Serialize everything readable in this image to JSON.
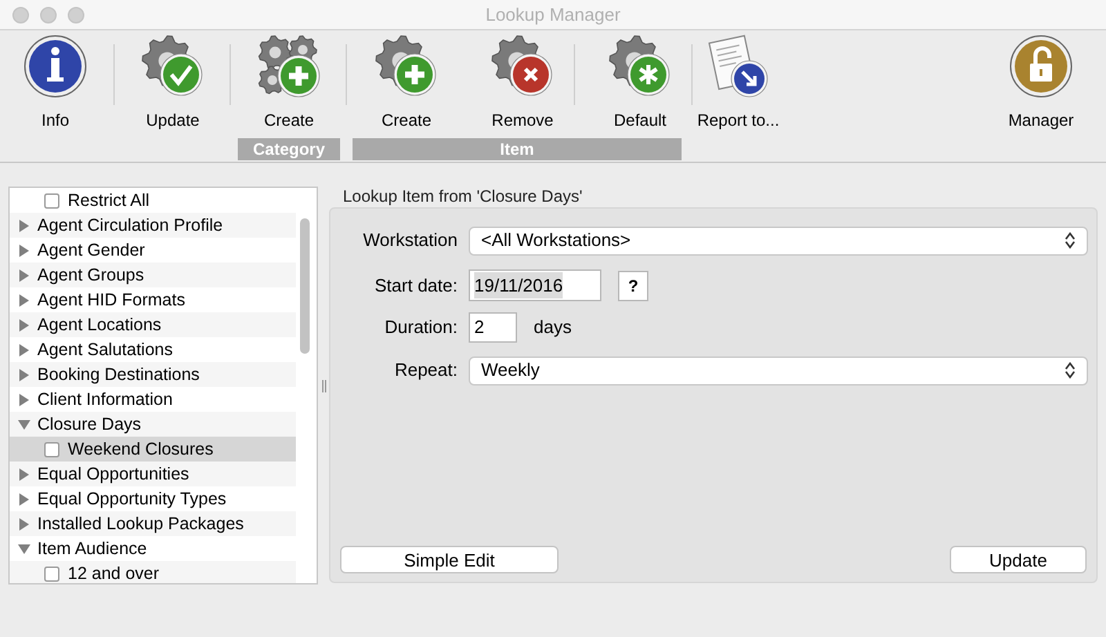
{
  "window": {
    "title": "Lookup Manager"
  },
  "toolbar": [
    {
      "label": "Info",
      "kind": "info"
    },
    {
      "label": "Update",
      "kind": "update"
    },
    {
      "label": "Create",
      "kind": "create_many"
    },
    {
      "label": "Create",
      "kind": "create"
    },
    {
      "label": "Remove",
      "kind": "remove"
    },
    {
      "label": "Default",
      "kind": "default"
    },
    {
      "label": "Report to...",
      "kind": "report"
    },
    {
      "label": "Manager",
      "kind": "lock"
    }
  ],
  "toolbar_groups": [
    {
      "label": "Category"
    },
    {
      "label": "Item"
    }
  ],
  "tree": [
    {
      "label": "Restrict All",
      "kind": "checkbox",
      "checked": false,
      "selected": false
    },
    {
      "label": "Agent Circulation Profile",
      "kind": "category",
      "expanded": false,
      "selected": false
    },
    {
      "label": "Agent Gender",
      "kind": "category",
      "expanded": false,
      "selected": false
    },
    {
      "label": "Agent Groups",
      "kind": "category",
      "expanded": false,
      "selected": false
    },
    {
      "label": "Agent HID Formats",
      "kind": "category",
      "expanded": false,
      "selected": false
    },
    {
      "label": "Agent Locations",
      "kind": "category",
      "expanded": false,
      "selected": false
    },
    {
      "label": "Agent Salutations",
      "kind": "category",
      "expanded": false,
      "selected": false
    },
    {
      "label": "Booking Destinations",
      "kind": "category",
      "expanded": false,
      "selected": false
    },
    {
      "label": "Client Information",
      "kind": "category",
      "expanded": false,
      "selected": false
    },
    {
      "label": "Closure Days",
      "kind": "category",
      "expanded": true,
      "selected": false,
      "children": [
        {
          "label": "Weekend Closures",
          "kind": "checkbox",
          "checked": false,
          "selected": true
        }
      ]
    },
    {
      "label": "Equal Opportunities",
      "kind": "category",
      "expanded": false,
      "selected": false
    },
    {
      "label": "Equal Opportunity Types",
      "kind": "category",
      "expanded": false,
      "selected": false
    },
    {
      "label": "Installed Lookup Packages",
      "kind": "category",
      "expanded": false,
      "selected": false
    },
    {
      "label": "Item Audience",
      "kind": "category",
      "expanded": true,
      "selected": false,
      "children": [
        {
          "label": "12 and over",
          "kind": "checkbox",
          "checked": false,
          "selected": false
        }
      ]
    }
  ],
  "detail": {
    "heading": "Lookup Item from 'Closure Days'",
    "workstation": {
      "label": "Workstation",
      "value": "<All Workstations>"
    },
    "start_date": {
      "label": "Start date:",
      "value": "19/11/2016",
      "help": "?"
    },
    "duration": {
      "label": "Duration:",
      "value": "2",
      "unit": "days"
    },
    "repeat": {
      "label": "Repeat:",
      "value": "Weekly"
    },
    "buttons": [
      "Simple Edit",
      "Update"
    ]
  }
}
